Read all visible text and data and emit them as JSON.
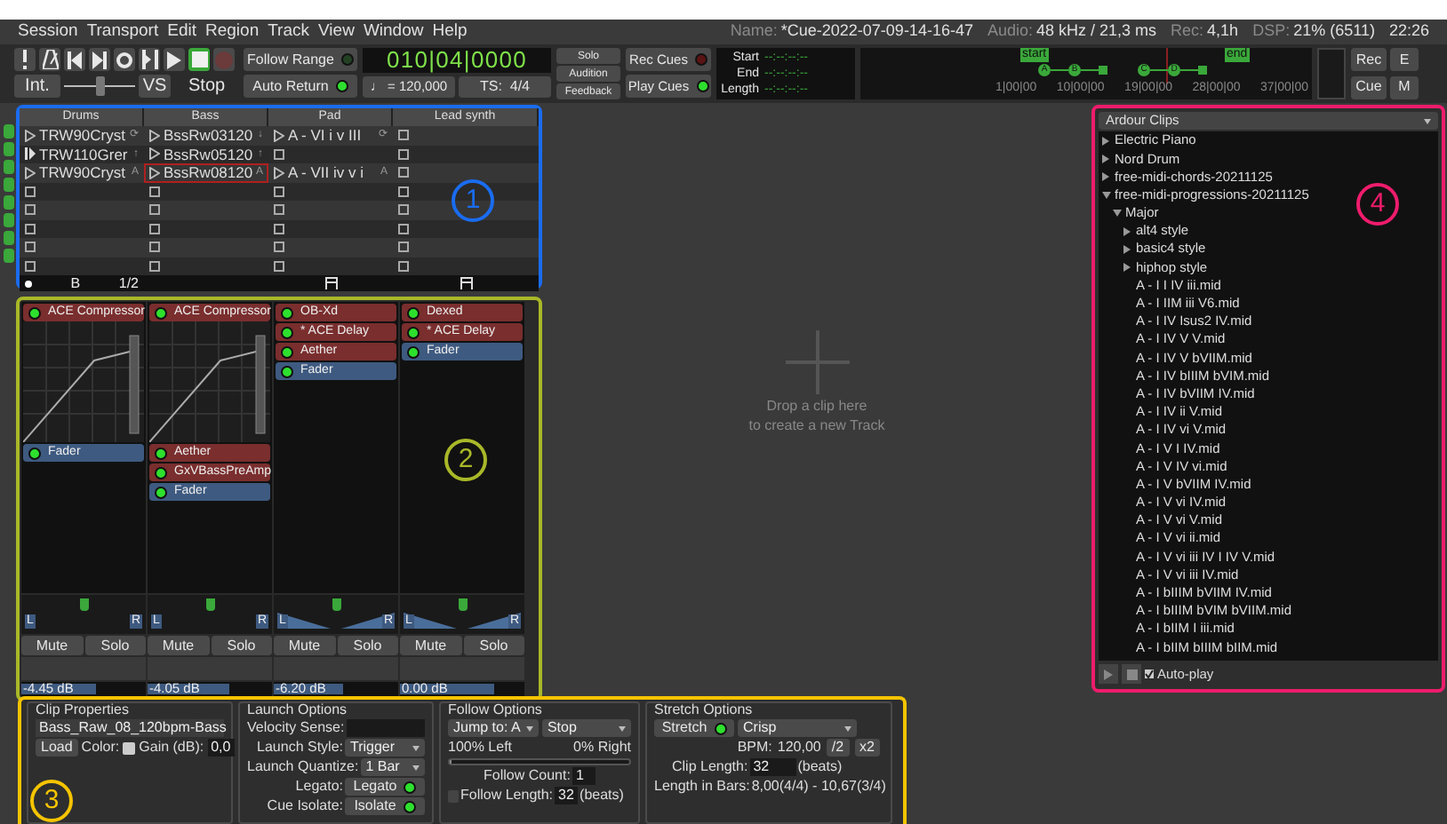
{
  "menu": [
    "Session",
    "Transport",
    "Edit",
    "Region",
    "Track",
    "View",
    "Window",
    "Help"
  ],
  "status": [
    {
      "label": "Name:",
      "value": "*Cue-2022-07-09-14-16-47"
    },
    {
      "label": "Audio:",
      "value": "48 kHz / 21,3 ms"
    },
    {
      "label": "Rec:",
      "value": "4,1h"
    },
    {
      "label": "DSP:",
      "value": "21% (6511)"
    }
  ],
  "clock_time": "22:26",
  "transport": [
    {
      "kind": "panic",
      "active": false
    },
    {
      "kind": "metronome",
      "active": false
    },
    {
      "kind": "to-start",
      "active": false
    },
    {
      "kind": "to-end",
      "active": false
    },
    {
      "kind": "loop",
      "active": false
    },
    {
      "kind": "punch",
      "active": false
    },
    {
      "kind": "play",
      "active": false
    },
    {
      "kind": "stop",
      "active": true
    },
    {
      "kind": "record",
      "active": false
    }
  ],
  "shuttle": {
    "mode": "Int.",
    "level": 0.5,
    "vs": "VS",
    "state": "Stop"
  },
  "toggles": [
    {
      "label": "Follow Range",
      "on": false
    },
    {
      "label": "Auto Return",
      "on": true
    }
  ],
  "clock": {
    "bbt": "010|04|0000",
    "tempo": "♩ = 120,000",
    "meter": "TS:  4/4"
  },
  "monitor": [
    "Solo",
    "Audition",
    "Feedback"
  ],
  "cues": [
    {
      "label": "Rec Cues",
      "on": false
    },
    {
      "label": "Play Cues",
      "on": true
    }
  ],
  "range": [
    {
      "label": "Start",
      "value": "--:--:--:--"
    },
    {
      "label": "End",
      "value": "--:--:--:--"
    },
    {
      "label": "Length",
      "value": "--:--:--:--"
    }
  ],
  "mini_timeline": {
    "flags": [
      "start",
      "end"
    ],
    "markers": [
      "A",
      "B",
      "C",
      "D"
    ],
    "ruler": [
      "1|00|00",
      "10|00|00",
      "19|00|00",
      "28|00|00",
      "37|00|00"
    ]
  },
  "right_buttons": [
    "Rec",
    "E",
    "Cue",
    "M"
  ],
  "clip_grid": {
    "columns": [
      "Drums",
      "Bass",
      "Pad",
      "Lead synth"
    ],
    "rows": [
      [
        {
          "name": "TRW90Cryst",
          "action": "⟳",
          "playing": false,
          "selected": false
        },
        {
          "name": "BssRw03120",
          "action": "↓",
          "playing": false,
          "selected": false
        },
        {
          "name": "A - VI i v III",
          "action": "⟳",
          "playing": false,
          "selected": false
        },
        {
          "selected": false
        }
      ],
      [
        {
          "name": "TRW110Grer",
          "action": "↑",
          "playing": true,
          "selected": false
        },
        {
          "name": "BssRw05120",
          "action": "↑",
          "playing": false,
          "selected": false
        },
        {
          "selected": false
        },
        {
          "selected": false
        }
      ],
      [
        {
          "name": "TRW90Cryst",
          "action": "A",
          "playing": false,
          "selected": false
        },
        {
          "name": "BssRw08120",
          "action": "A",
          "playing": false,
          "selected": true
        },
        {
          "name": "A - VII iv v i",
          "action": "A",
          "playing": false,
          "selected": false
        },
        {
          "selected": false
        }
      ],
      [
        {
          "selected": false
        },
        {
          "selected": false
        },
        {
          "selected": false
        },
        {
          "selected": false
        }
      ],
      [
        {
          "selected": false
        },
        {
          "selected": false
        },
        {
          "selected": false
        },
        {
          "selected": false
        }
      ],
      [
        {
          "selected": false
        },
        {
          "selected": false
        },
        {
          "selected": false
        },
        {
          "selected": false
        }
      ],
      [
        {
          "selected": false
        },
        {
          "selected": false
        },
        {
          "selected": false
        },
        {
          "selected": false
        }
      ],
      [
        {
          "selected": false
        },
        {
          "selected": false
        },
        {
          "selected": false
        },
        {
          "selected": false
        }
      ]
    ],
    "footer": [
      {
        "kind": "cue",
        "letter": "B",
        "count": "1/2"
      },
      {
        "kind": "none"
      },
      {
        "kind": "midi"
      },
      {
        "kind": "midi"
      }
    ]
  },
  "strips": [
    {
      "plugins": [
        {
          "name": "ACE Compressor",
          "kind": "compressor"
        },
        {
          "name": "Fader",
          "kind": "fader"
        }
      ],
      "kind": "balance",
      "pan_labels": [
        "L",
        "R"
      ],
      "mute": "Mute",
      "solo": "Solo",
      "gain": "-4.45 dB",
      "level": 0.6
    },
    {
      "plugins": [
        {
          "name": "ACE Compressor",
          "kind": "compressor"
        },
        {
          "name": "Aether",
          "kind": "plugin"
        },
        {
          "name": "GxVBassPreAmp",
          "kind": "plugin"
        },
        {
          "name": "Fader",
          "kind": "fader"
        }
      ],
      "kind": "balance",
      "pan_labels": [
        "L",
        "R"
      ],
      "mute": "Mute",
      "solo": "Solo",
      "gain": "-4.05 dB",
      "level": 0.65
    },
    {
      "plugins": [
        {
          "name": "OB-Xd",
          "kind": "plugin"
        },
        {
          "name": "* ACE Delay",
          "kind": "plugin"
        },
        {
          "name": "Aether",
          "kind": "plugin"
        },
        {
          "name": "Fader",
          "kind": "fader"
        }
      ],
      "kind": "width",
      "pan_labels": [
        "L",
        "R"
      ],
      "mute": "Mute",
      "solo": "Solo",
      "gain": "-6.20 dB",
      "level": 0.55
    },
    {
      "plugins": [
        {
          "name": "Dexed",
          "kind": "plugin"
        },
        {
          "name": "* ACE Delay",
          "kind": "plugin"
        },
        {
          "name": "Fader",
          "kind": "fader"
        }
      ],
      "kind": "width",
      "pan_labels": [
        "L",
        "R"
      ],
      "mute": "Mute",
      "solo": "Solo",
      "gain": "0.00 dB",
      "level": 0.75
    }
  ],
  "drop_hint": [
    "Drop a clip here",
    "to create a new Track"
  ],
  "clips_browser": {
    "source": "Ardour Clips",
    "tree": [
      {
        "name": "Electric Piano",
        "kind": "folder",
        "expanded": false
      },
      {
        "name": "Nord Drum",
        "kind": "folder",
        "expanded": false
      },
      {
        "name": "free-midi-chords-20211125",
        "kind": "folder",
        "expanded": false
      },
      {
        "name": "free-midi-progressions-20211125",
        "kind": "folder",
        "expanded": true,
        "children": [
          {
            "name": "Major",
            "kind": "folder",
            "expanded": true,
            "children": [
              {
                "name": "alt4 style",
                "kind": "folder",
                "expanded": false
              },
              {
                "name": "basic4 style",
                "kind": "folder",
                "expanded": false
              },
              {
                "name": "hiphop style",
                "kind": "folder",
                "expanded": false
              },
              {
                "name": "A - I I IV iii.mid",
                "kind": "file"
              },
              {
                "name": "A - I IIM iii V6.mid",
                "kind": "file"
              },
              {
                "name": "A - I IV Isus2 IV.mid",
                "kind": "file"
              },
              {
                "name": "A - I IV V V.mid",
                "kind": "file"
              },
              {
                "name": "A - I IV V bVIIM.mid",
                "kind": "file"
              },
              {
                "name": "A - I IV bIIIM bVIM.mid",
                "kind": "file"
              },
              {
                "name": "A - I IV bVIIM IV.mid",
                "kind": "file"
              },
              {
                "name": "A - I IV ii V.mid",
                "kind": "file"
              },
              {
                "name": "A - I IV vi V.mid",
                "kind": "file"
              },
              {
                "name": "A - I V I IV.mid",
                "kind": "file"
              },
              {
                "name": "A - I V IV vi.mid",
                "kind": "file"
              },
              {
                "name": "A - I V bVIIM IV.mid",
                "kind": "file"
              },
              {
                "name": "A - I V vi IV.mid",
                "kind": "file"
              },
              {
                "name": "A - I V vi V.mid",
                "kind": "file"
              },
              {
                "name": "A - I V vi ii.mid",
                "kind": "file"
              },
              {
                "name": "A - I V vi iii IV I IV V.mid",
                "kind": "file"
              },
              {
                "name": "A - I V vi iii IV.mid",
                "kind": "file"
              },
              {
                "name": "A - I bIIIM bVIIM IV.mid",
                "kind": "file"
              },
              {
                "name": "A - I bIIIM bVIM bVIIM.mid",
                "kind": "file"
              },
              {
                "name": "A - I bIIM I iii.mid",
                "kind": "file"
              },
              {
                "name": "A - I bIIM bIIIM bIIM.mid",
                "kind": "file"
              }
            ]
          }
        ]
      }
    ],
    "autoplay": {
      "label": "Auto-play",
      "checked": true
    }
  },
  "clip_properties": {
    "title": "Clip Properties",
    "name": "Bass_Raw_08_120bpm-Bass",
    "load": "Load",
    "color_label": "Color:",
    "gain_label": "Gain (dB):",
    "gain": "0,0"
  },
  "launch_options": {
    "title": "Launch Options",
    "velocity_label": "Velocity Sense:",
    "rows": [
      {
        "label": "Launch Style:",
        "value": "Trigger",
        "kind": "dropdown"
      },
      {
        "label": "Launch Quantize:",
        "value": "1 Bar",
        "kind": "dropdown"
      },
      {
        "label": "Legato:",
        "value": "Legato",
        "kind": "toggle",
        "on": true
      },
      {
        "label": "Cue Isolate:",
        "value": "Isolate",
        "kind": "toggle",
        "on": true
      }
    ]
  },
  "follow_options": {
    "title": "Follow Options",
    "action_1": "Jump to: A",
    "action_2": "Stop",
    "left": "100% Left",
    "right": "0% Right",
    "level": 0,
    "count_label": "Follow Count:",
    "count": "1",
    "length_label": "Follow Length:",
    "length_checked": false,
    "length": "32",
    "length_unit": "(beats)"
  },
  "stretch_options": {
    "title": "Stretch Options",
    "stretch": "Stretch",
    "stretch_on": true,
    "mode": "Crisp",
    "bpm_label": "BPM:",
    "bpm": "120,00",
    "half": "/2",
    "double": "x2",
    "clip_length_label": "Clip Length:",
    "clip_length": "32",
    "clip_length_unit": "(beats)",
    "bars_label": "Length in Bars:",
    "bars": "8,00(4/4) - 10,67(3/4)"
  },
  "annotations": [
    {
      "label": "1",
      "color": "#1a6cf0"
    },
    {
      "label": "2",
      "color": "#a8b828"
    },
    {
      "label": "3",
      "color": "#f5c400"
    },
    {
      "label": "4",
      "color": "#ee1c6c"
    }
  ]
}
